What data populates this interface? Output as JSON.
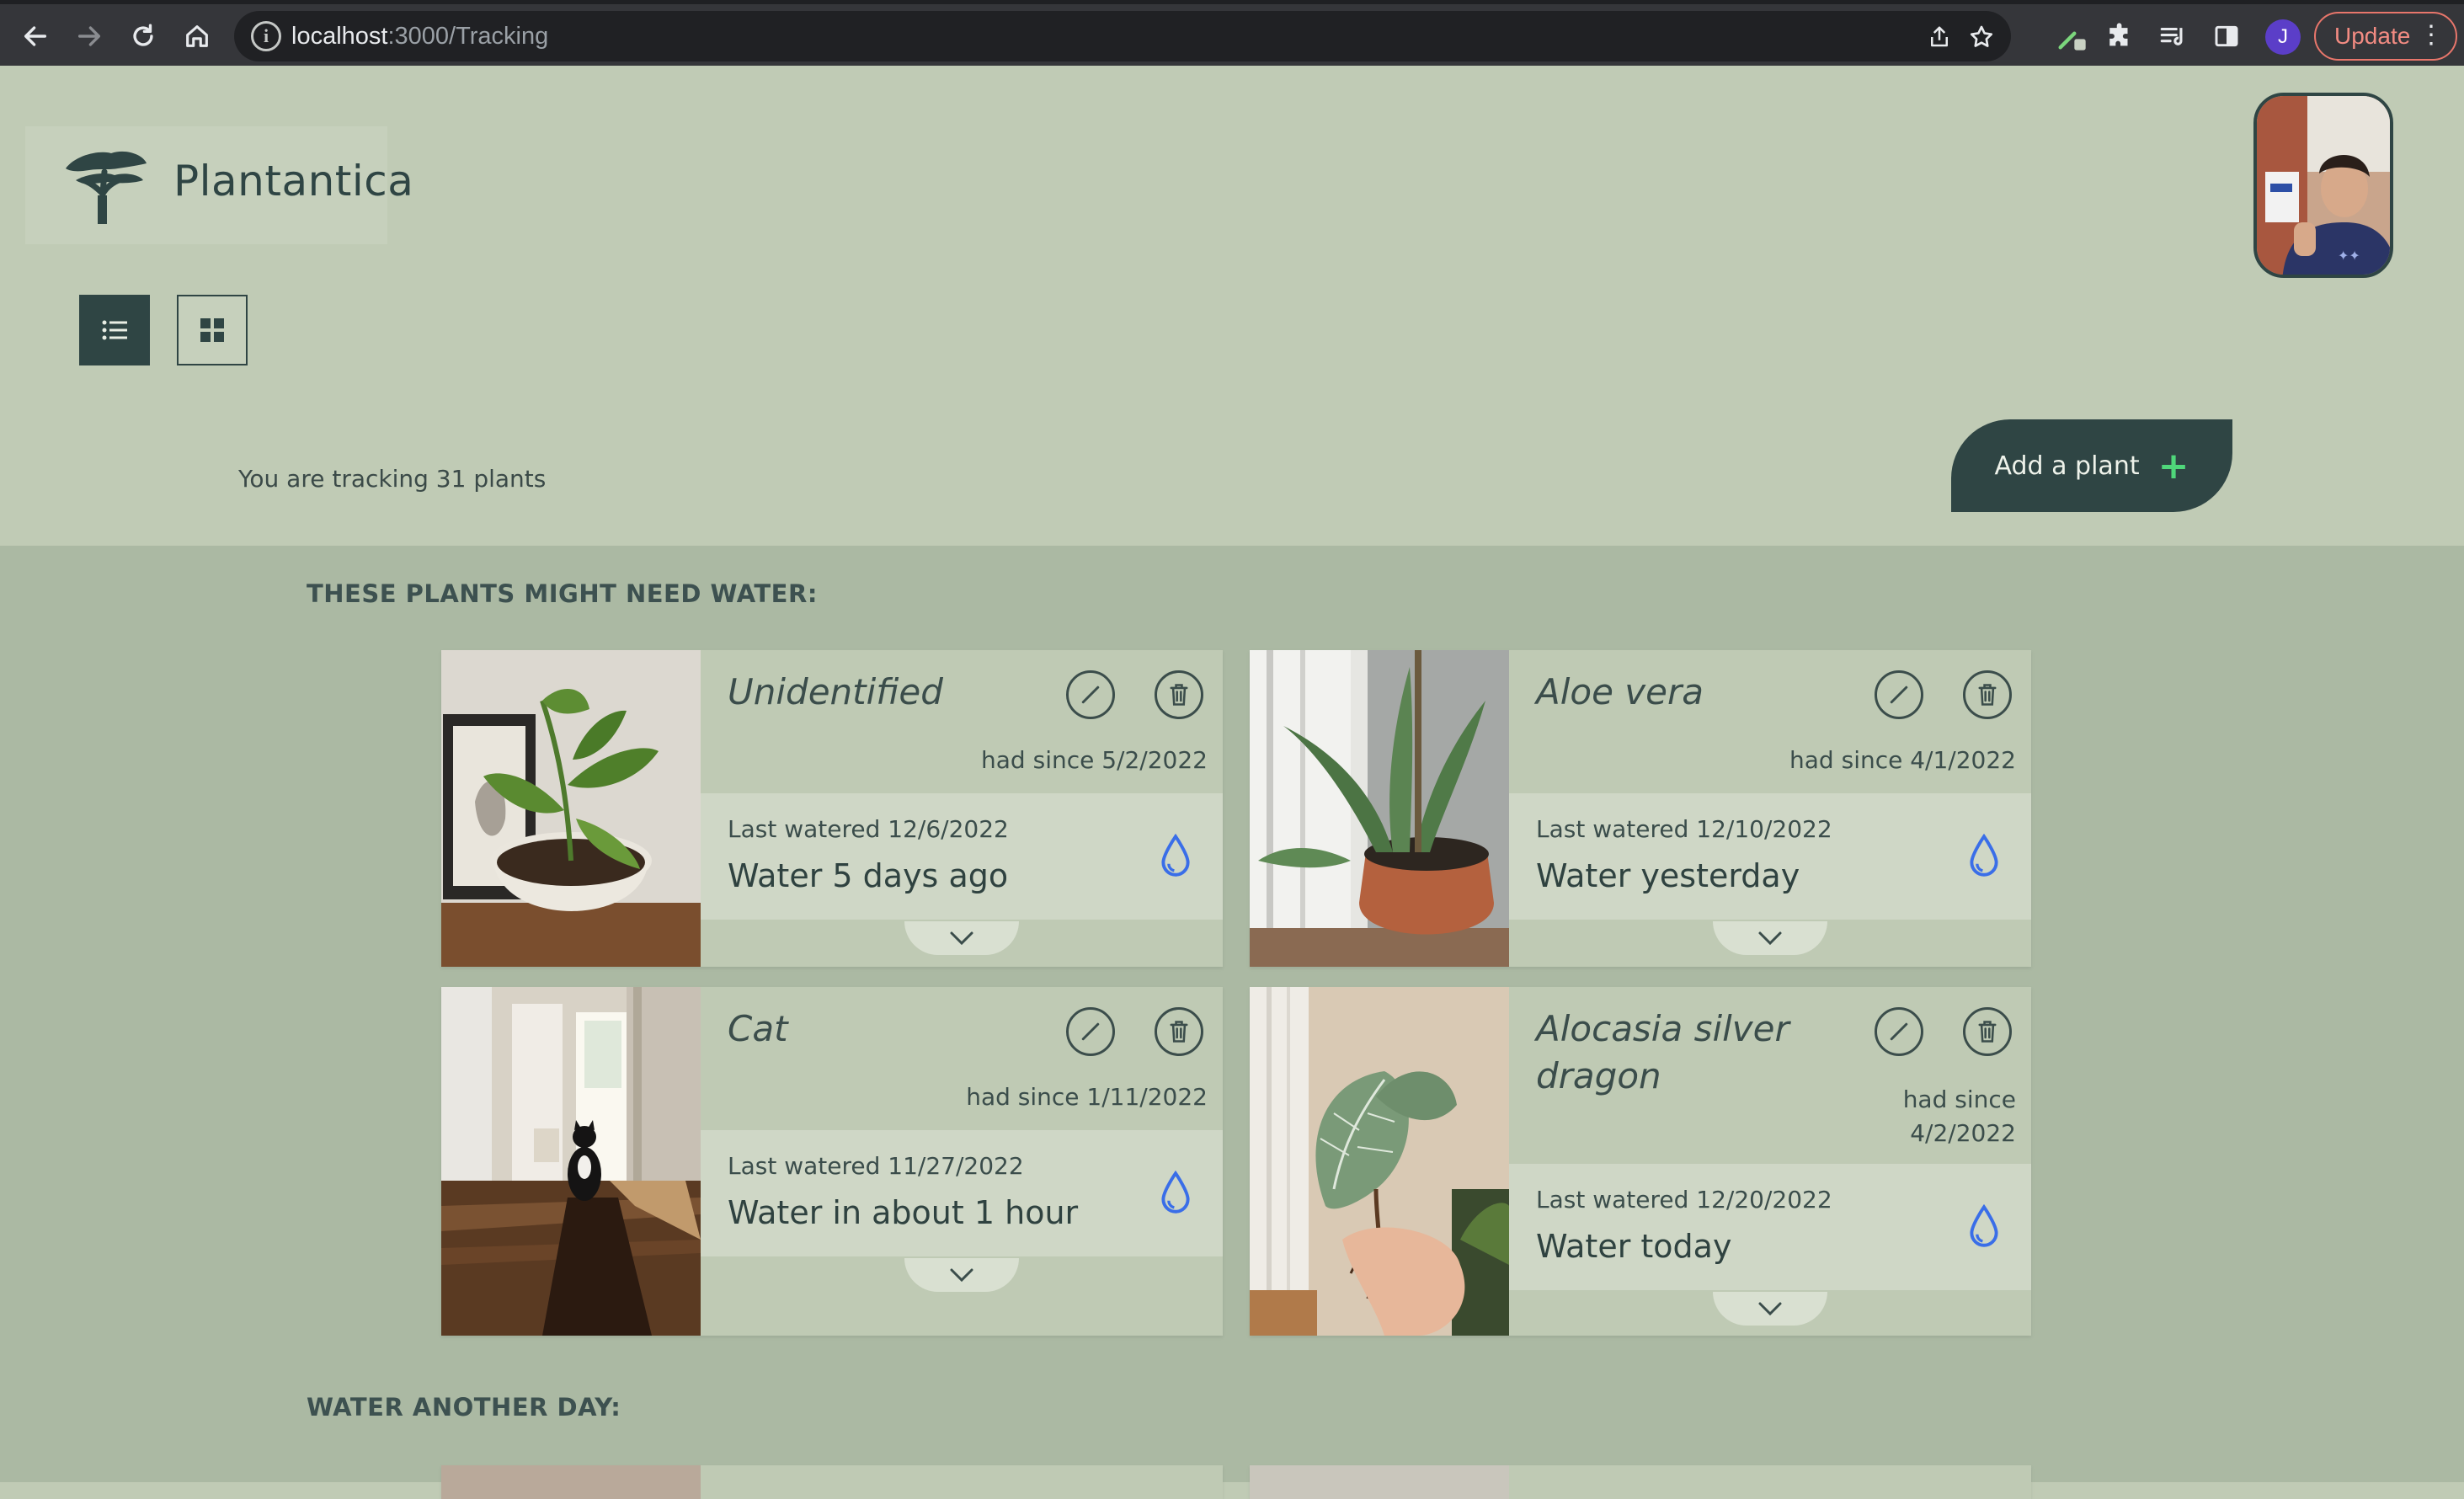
{
  "browser": {
    "url_host": "localhost",
    "url_path": ":3000/Tracking",
    "profile_initial": "J",
    "update_label": "Update"
  },
  "app": {
    "name": "Plantantica",
    "tracking_text": "You are tracking 31 plants",
    "add_plant_label": "Add a plant",
    "add_plant_icon": "+"
  },
  "sections": {
    "needs_water_title": "THESE PLANTS MIGHT NEED WATER:",
    "another_day_title": "WATER ANOTHER DAY:"
  },
  "plants": [
    {
      "name": "Unidentified",
      "had_since": "had since 5/2/2022",
      "last_watered": "Last watered 12/6/2022",
      "status": "Water 5 days ago"
    },
    {
      "name": "Aloe vera",
      "had_since": "had since 4/1/2022",
      "last_watered": "Last watered 12/10/2022",
      "status": "Water yesterday"
    },
    {
      "name": "Cat",
      "had_since": "had since 1/11/2022",
      "last_watered": "Last watered 11/27/2022",
      "status": "Water in about 1 hour"
    },
    {
      "name": "Alocasia silver dragon",
      "had_since_line1": "had since",
      "had_since_line2": "4/2/2022",
      "last_watered": "Last watered 12/20/2022",
      "status": "Water today"
    }
  ],
  "colors": {
    "page_bg": "#c0cbb5",
    "main_bg": "#abb9a3",
    "accent_dark": "#2f4544",
    "drop_blue": "#3a6ee8",
    "plus_green": "#4fd67a"
  }
}
